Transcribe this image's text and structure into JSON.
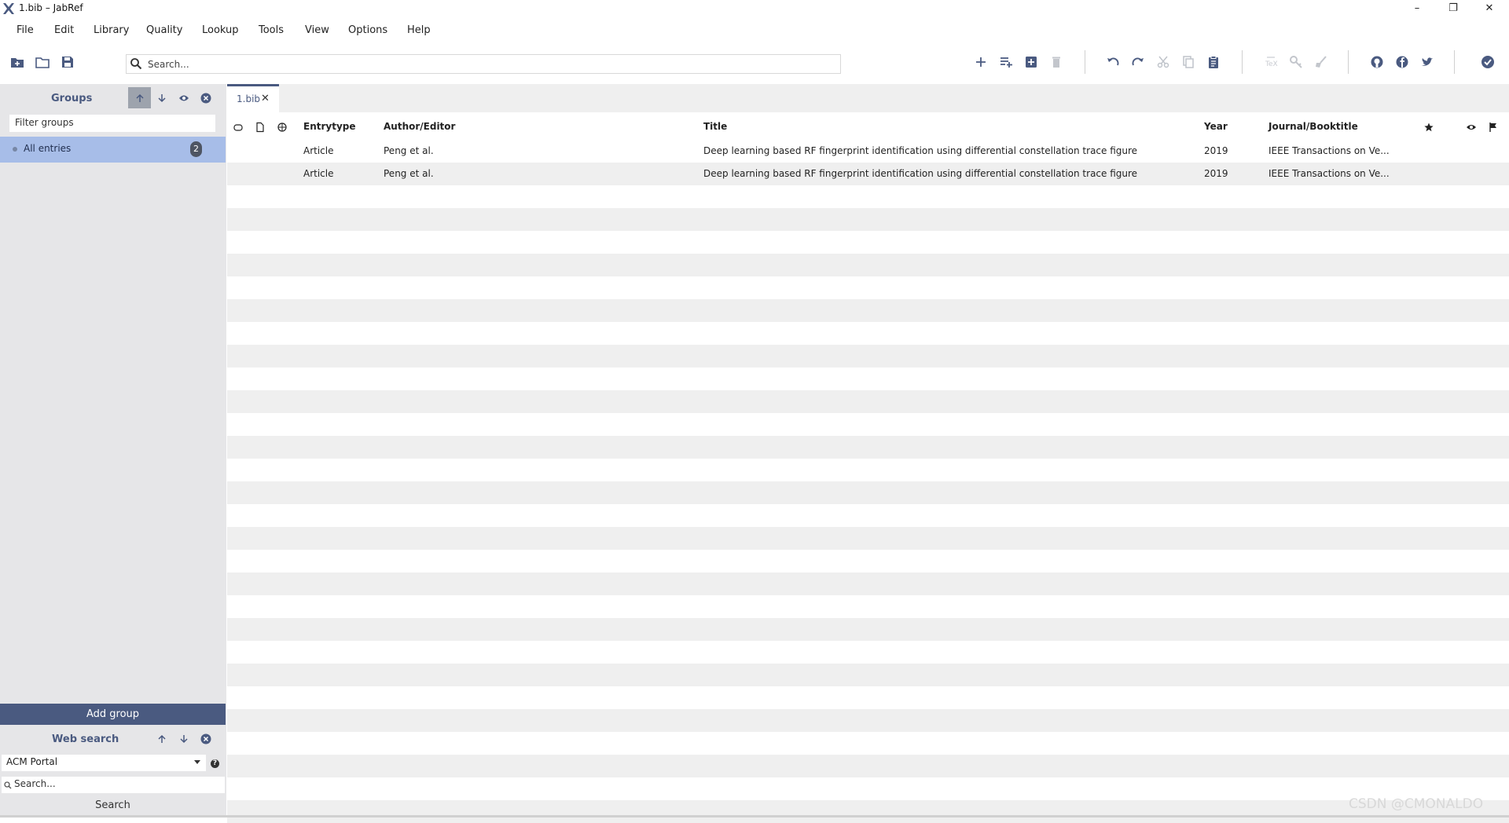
{
  "window": {
    "title": "1.bib – JabRef",
    "controls": {
      "minimize": "–",
      "restore": "❐",
      "close": "✕"
    }
  },
  "menu": [
    "File",
    "Edit",
    "Library",
    "Quality",
    "Lookup",
    "Tools",
    "View",
    "Options",
    "Help"
  ],
  "toolbar": {
    "search_placeholder": "Search...",
    "left_icons": [
      "new-library-icon",
      "open-library-icon",
      "save-library-icon"
    ],
    "right_icons": [
      "add-entry-icon",
      "add-entry-from-id-icon",
      "new-entry-plus-box-icon",
      "delete-entry-icon",
      "undo-icon",
      "redo-icon",
      "cut-icon",
      "copy-icon",
      "paste-icon",
      "push-to-tex-icon",
      "get-bibtex-key-icon",
      "cleanup-entries-icon",
      "github-icon",
      "facebook-icon",
      "twitter-icon",
      "check-integrity-icon"
    ]
  },
  "groups_panel": {
    "title": "Groups",
    "filter_placeholder": "Filter groups",
    "all_entries": {
      "label": "All entries",
      "count": "2"
    },
    "add_group_label": "Add group"
  },
  "web_search": {
    "title": "Web search",
    "fetcher": "ACM Portal",
    "search_placeholder": "Search...",
    "help_glyph": "?",
    "search_button": "Search"
  },
  "tabs": [
    {
      "label": "1.bib",
      "close": "✕"
    }
  ],
  "table": {
    "columns": [
      "Entrytype",
      "Author/Editor",
      "Title",
      "Year",
      "Journal/Booktitle"
    ],
    "rows": [
      {
        "entrytype": "Article",
        "author": "Peng et al.",
        "title": "Deep learning based RF fingerprint identification using differential constellation trace figure",
        "year": "2019",
        "journal": "IEEE Transactions on Ve..."
      },
      {
        "entrytype": "Article",
        "author": "Peng et al.",
        "title": "Deep learning based RF fingerprint identification using differential constellation trace figure",
        "year": "2019",
        "journal": "IEEE Transactions on Ve..."
      }
    ]
  },
  "watermark": "CSDN @CMONALDO",
  "colors": {
    "accent": "#4a5a80",
    "selected_row": "#a7bde8",
    "panel_bg": "#e6e6e8",
    "stripe": "#efefef"
  }
}
